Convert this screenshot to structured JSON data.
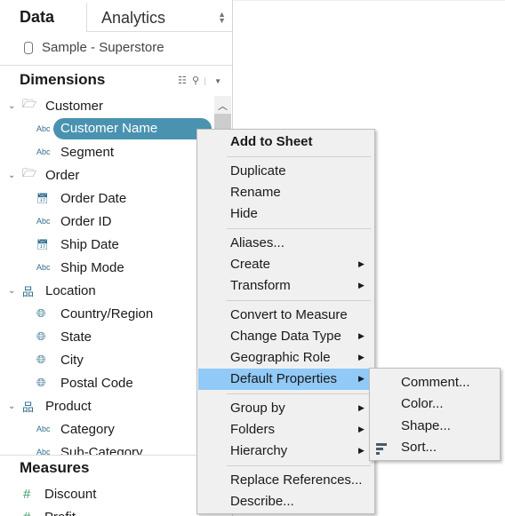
{
  "sidebar": {
    "tab_data": "Data",
    "tab_analytics": "Analytics",
    "datasource": "Sample - Superstore",
    "dimensions_title": "Dimensions",
    "measures_title": "Measures",
    "tree": [
      {
        "type": "folder",
        "label": "Customer"
      },
      {
        "type": "abc",
        "label": "Customer Name",
        "selected": true
      },
      {
        "type": "abc",
        "label": "Segment"
      },
      {
        "type": "folder",
        "label": "Order"
      },
      {
        "type": "date",
        "label": "Order Date"
      },
      {
        "type": "abc",
        "label": "Order ID"
      },
      {
        "type": "date",
        "label": "Ship Date"
      },
      {
        "type": "abc",
        "label": "Ship Mode"
      },
      {
        "type": "hierarchy",
        "label": "Location"
      },
      {
        "type": "geo",
        "label": "Country/Region"
      },
      {
        "type": "geo",
        "label": "State"
      },
      {
        "type": "geo",
        "label": "City"
      },
      {
        "type": "geo",
        "label": "Postal Code"
      },
      {
        "type": "hierarchy",
        "label": "Product"
      },
      {
        "type": "abc",
        "label": "Category"
      },
      {
        "type": "abc",
        "label": "Sub-Category"
      }
    ],
    "measures": [
      "Discount",
      "Profit"
    ],
    "abc_label": "Abc"
  },
  "context_menu": {
    "items": [
      {
        "label": "Add to Sheet",
        "bold": true
      },
      {
        "sep": true
      },
      {
        "label": "Duplicate"
      },
      {
        "label": "Rename"
      },
      {
        "label": "Hide"
      },
      {
        "sep": true
      },
      {
        "label": "Aliases..."
      },
      {
        "label": "Create",
        "submenu": true
      },
      {
        "label": "Transform",
        "submenu": true
      },
      {
        "sep": true
      },
      {
        "label": "Convert to Measure"
      },
      {
        "label": "Change Data Type",
        "submenu": true
      },
      {
        "label": "Geographic Role",
        "submenu": true
      },
      {
        "label": "Default Properties",
        "submenu": true,
        "highlighted": true
      },
      {
        "sep": true
      },
      {
        "label": "Group by",
        "submenu": true
      },
      {
        "label": "Folders",
        "submenu": true
      },
      {
        "label": "Hierarchy",
        "submenu": true
      },
      {
        "sep": true
      },
      {
        "label": "Replace References..."
      },
      {
        "label": "Describe..."
      }
    ]
  },
  "submenu": {
    "items": [
      {
        "label": "Comment..."
      },
      {
        "label": "Color..."
      },
      {
        "label": "Shape..."
      },
      {
        "label": "Sort...",
        "icon": "sort-icon"
      }
    ]
  },
  "colors": {
    "selected_pill": "#4a93b0",
    "highlight": "#91c9f7",
    "icon_blue": "#2f6e8e",
    "measure_green": "#3a9a6a"
  }
}
